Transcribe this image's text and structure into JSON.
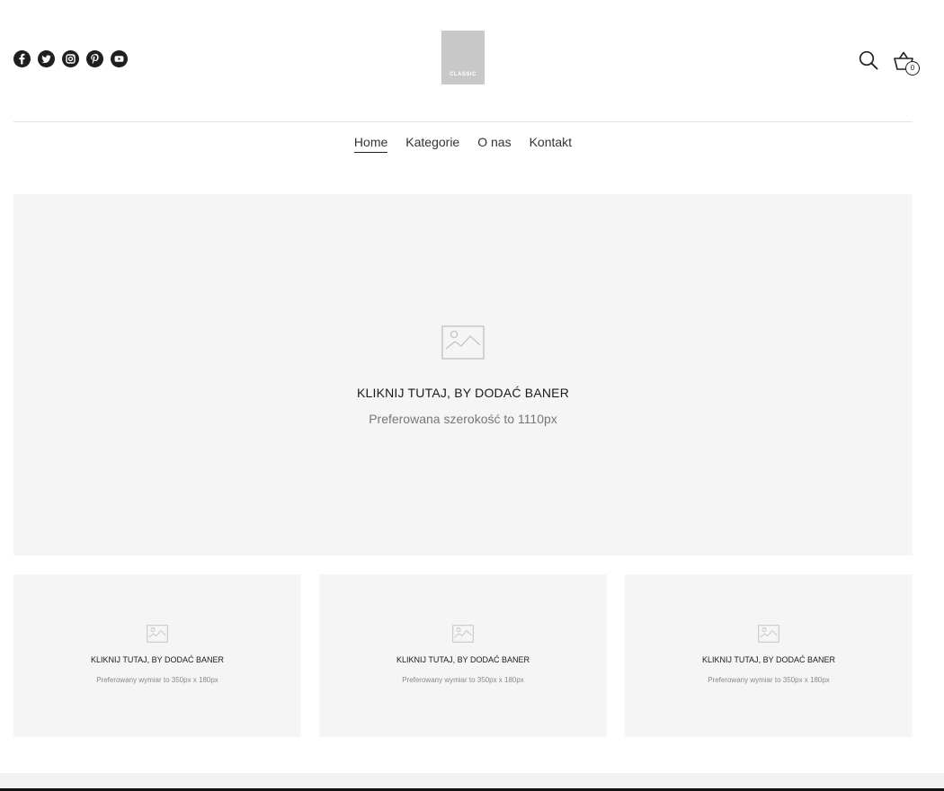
{
  "header": {
    "logo_text": "CLASSIC",
    "social_icons": [
      "facebook-icon",
      "twitter-icon",
      "instagram-icon",
      "pinterest-icon",
      "youtube-icon"
    ],
    "cart_count": "0"
  },
  "nav": {
    "items": [
      {
        "label": "Home",
        "active": true
      },
      {
        "label": "Kategorie",
        "active": false
      },
      {
        "label": "O nas",
        "active": false
      },
      {
        "label": "Kontakt",
        "active": false
      }
    ]
  },
  "hero": {
    "title": "KLIKNIJ TUTAJ, BY DODAĆ BANER",
    "subtitle": "Preferowana szerokość to 1110px"
  },
  "banners": [
    {
      "title": "KLIKNIJ TUTAJ, BY DODAĆ BANER",
      "subtitle": "Preferowany wymiar to 350px x 180px"
    },
    {
      "title": "KLIKNIJ TUTAJ, BY DODAĆ BANER",
      "subtitle": "Preferowany wymiar to 350px x 180px"
    },
    {
      "title": "KLIKNIJ TUTAJ, BY DODAĆ BANER",
      "subtitle": "Preferowany wymiar to 350px x 180px"
    }
  ],
  "colors": {
    "text": "#222222",
    "placeholder_bg": "#f5f5f5",
    "logo_bg": "#c8c8c8"
  }
}
